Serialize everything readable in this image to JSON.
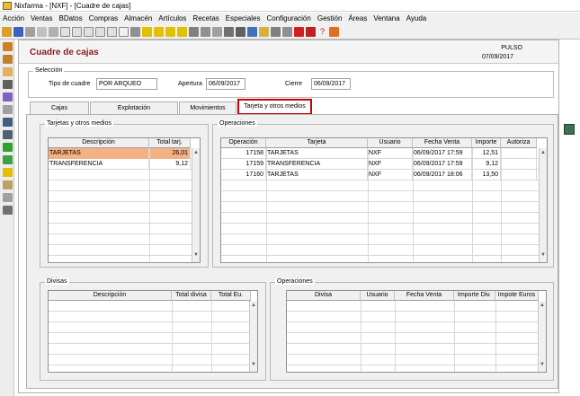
{
  "window": {
    "title": "Nixfarma - [NXF] - [Cuadre de cajas]"
  },
  "menu": [
    "Acción",
    "Ventas",
    "BDatos",
    "Compras",
    "Almacén",
    "Artículos",
    "Recetas",
    "Especiales",
    "Configuración",
    "Gestión",
    "Áreas",
    "Ventana",
    "Ayuda"
  ],
  "header": {
    "title": "Cuadre de cajas",
    "user": "PULSO",
    "date": "07/09/2017"
  },
  "seleccion": {
    "label": "Selección",
    "tipo_label": "Tipo de cuadre",
    "tipo_value": "POR ARQUEO",
    "apertura_label": "Apertura",
    "apertura_value": "06/09/2017",
    "cierre_label": "Cierre",
    "cierre_value": "06/09/2017"
  },
  "tabs": [
    "Cajas",
    "Explotación",
    "Movimientos",
    "Tarjeta y otros medios"
  ],
  "tarjetas": {
    "label": "Tarjetas y otros medios",
    "headers": [
      "Descripción",
      "Total tarj."
    ],
    "rows": [
      [
        "TARJETAS",
        "26,01"
      ],
      [
        "TRANSFERENCIA",
        "9,12"
      ]
    ]
  },
  "operaciones": {
    "label": "Operaciones",
    "headers": [
      "Operación",
      "Tarjeta",
      "Usuario",
      "Fecha Venta",
      "Importe",
      "Autoriza"
    ],
    "rows": [
      [
        "17158",
        "TARJETAS",
        "NXF",
        "06/09/2017 17:59",
        "12,51",
        ""
      ],
      [
        "17159",
        "TRANSFERENCIA",
        "NXF",
        "06/09/2017 17:59",
        "9,12",
        ""
      ],
      [
        "17160",
        "TARJETAS",
        "NXF",
        "06/09/2017 18:06",
        "13,50",
        ""
      ]
    ]
  },
  "divisas": {
    "label": "Divisas",
    "headers": [
      "Descripción",
      "Total divisa",
      "Total Eu."
    ]
  },
  "operaciones_divisas": {
    "label": "Operaciones",
    "headers": [
      "Divisa",
      "Usuario",
      "Fecha Venta",
      "Importe Div.",
      "Impote Euros"
    ]
  }
}
